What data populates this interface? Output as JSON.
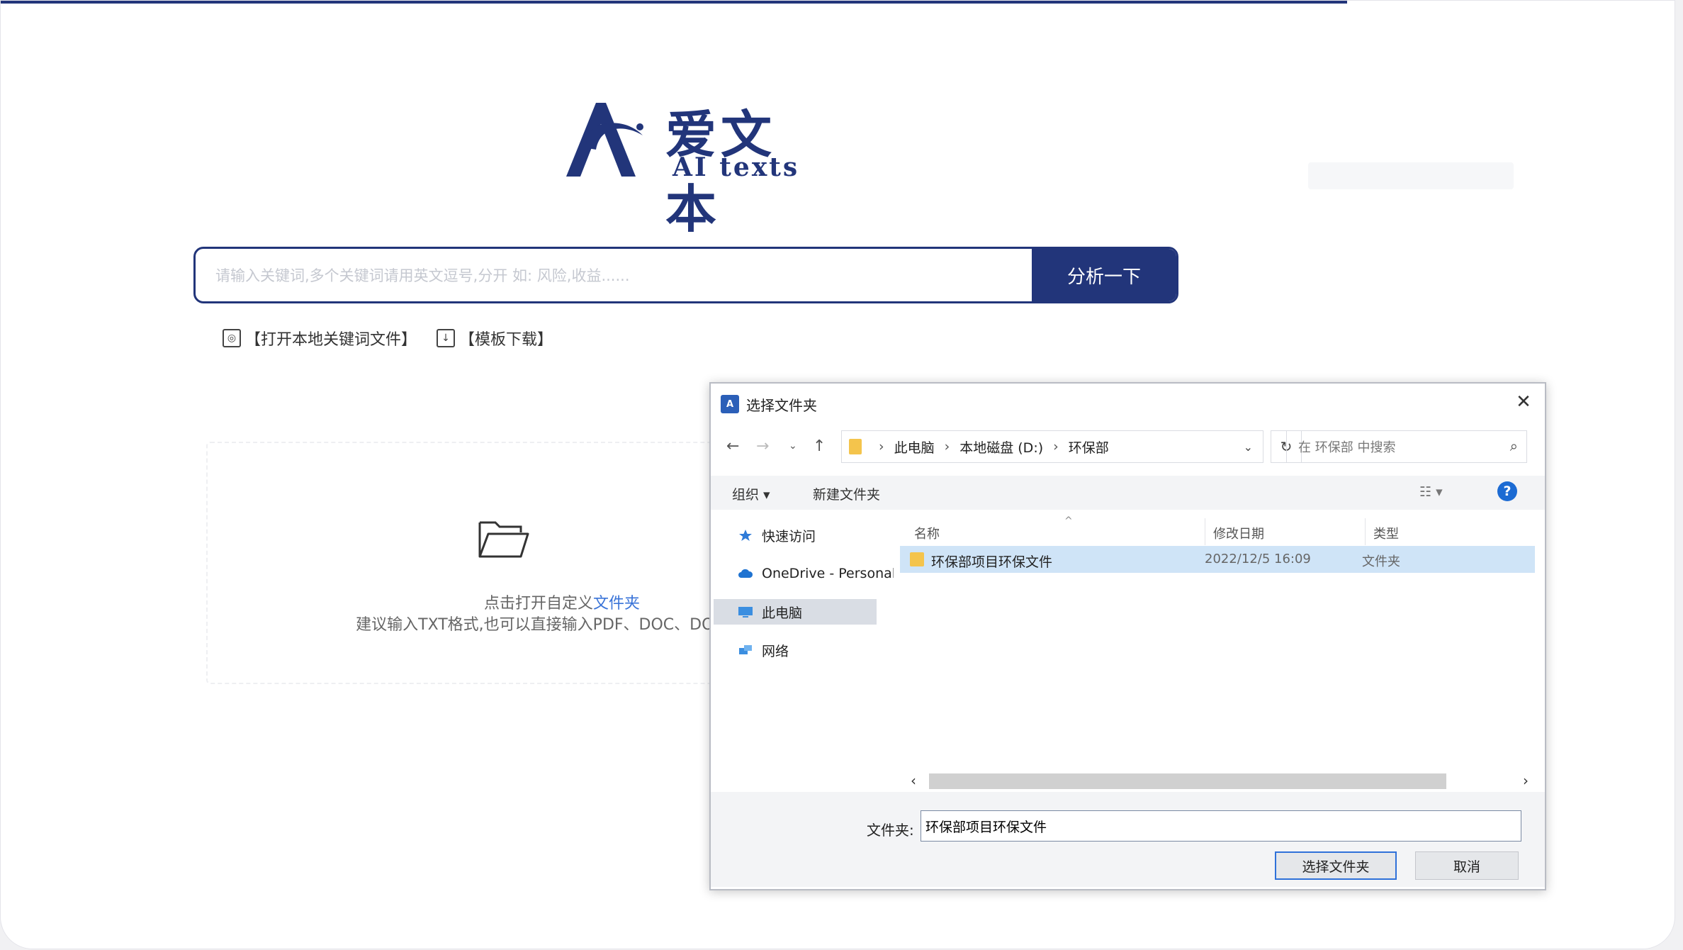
{
  "logo": {
    "cn": "爱文本",
    "en": "AI texts"
  },
  "search": {
    "placeholder": "请输入关键词,多个关键词请用英文逗号,分开 如: 风险,收益......",
    "button": "分析一下"
  },
  "links": {
    "open_local": "【打开本地关键词文件】",
    "template": "【模板下载】"
  },
  "upload": {
    "line1_prefix": "点击打开自定义",
    "line1_link": "文件夹",
    "hint": "建议输入TXT格式,也可以直接输入PDF、DOC、DOCX等格式"
  },
  "dialog": {
    "title": "选择文件夹",
    "close": "✕",
    "path": [
      "此电脑",
      "本地磁盘 (D:)",
      "环保部"
    ],
    "search_placeholder": "在 环保部 中搜索",
    "toolbar": {
      "organize": "组织 ▾",
      "new_folder": "新建文件夹"
    },
    "nav": [
      {
        "label": "快速访问",
        "icon": "star-icon"
      },
      {
        "label": "OneDrive - Personal",
        "icon": "cloud-icon"
      },
      {
        "label": "此电脑",
        "icon": "computer-icon"
      },
      {
        "label": "网络",
        "icon": "network-icon"
      }
    ],
    "columns": {
      "name": "名称",
      "date": "修改日期",
      "type": "类型"
    },
    "rows": [
      {
        "name": "环保部项目环保文件",
        "date": "2022/12/5 16:09",
        "type": "文件夹"
      }
    ],
    "folder_label": "文件夹:",
    "folder_value": "环保部项目环保文件",
    "select_button": "选择文件夹",
    "cancel_button": "取消"
  },
  "colors": {
    "brand": "#22357a",
    "link": "#3a74d8",
    "selection": "#cfe4f7"
  }
}
